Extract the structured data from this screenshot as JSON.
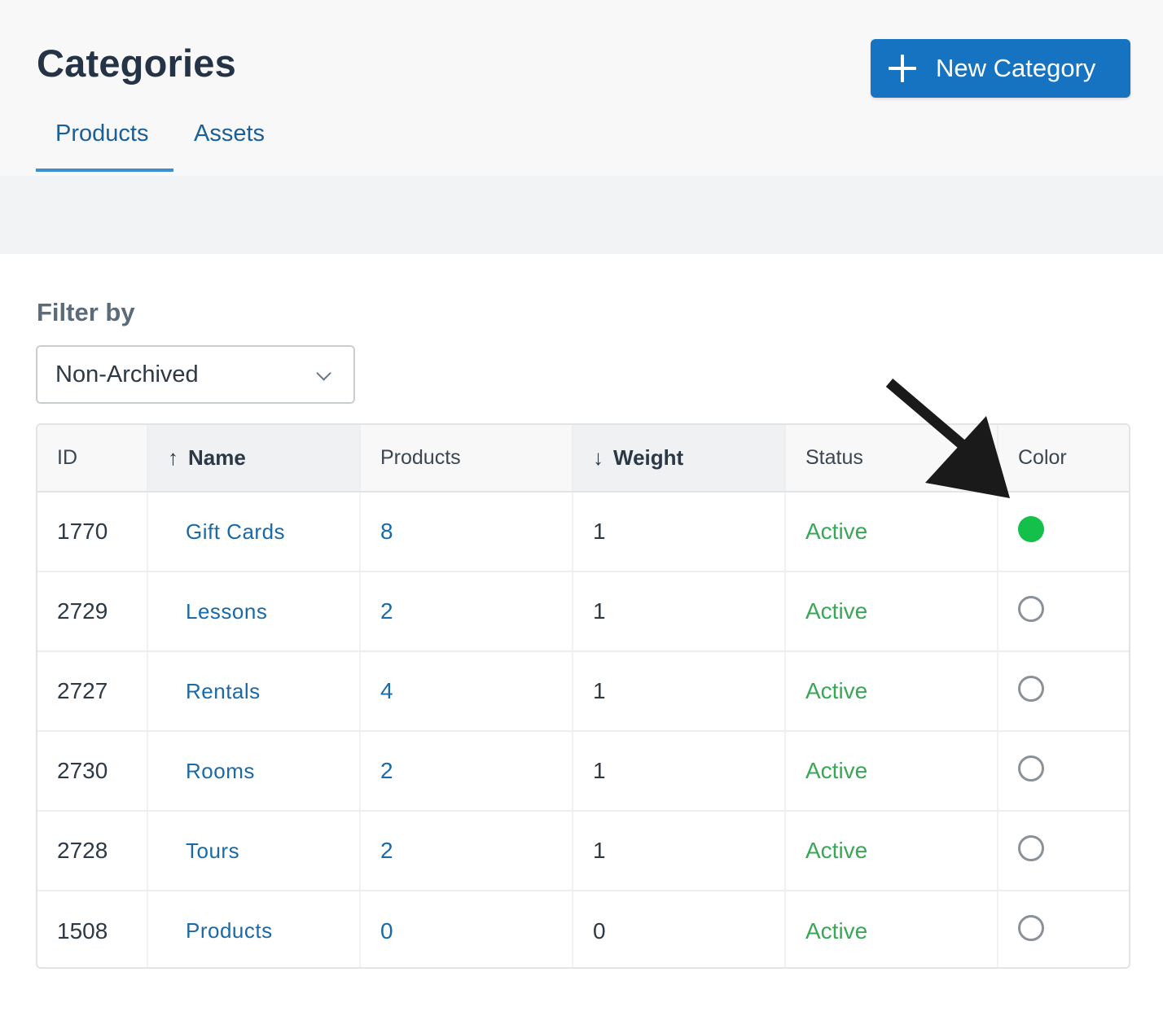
{
  "header": {
    "title": "Categories",
    "new_button_label": "New Category",
    "tabs": [
      {
        "label": "Products",
        "active": true
      },
      {
        "label": "Assets",
        "active": false
      }
    ]
  },
  "filter": {
    "label": "Filter by",
    "selected": "Non-Archived"
  },
  "table": {
    "columns": [
      {
        "label": "ID",
        "sort": ""
      },
      {
        "label": "Name",
        "sort": "↑"
      },
      {
        "label": "Products",
        "sort": ""
      },
      {
        "label": "Weight",
        "sort": "↓"
      },
      {
        "label": "Status",
        "sort": ""
      },
      {
        "label": "Color",
        "sort": ""
      }
    ],
    "rows": [
      {
        "id": "1770",
        "name": "Gift Cards",
        "products": "8",
        "weight": "1",
        "status": "Active",
        "color": "#15c04a"
      },
      {
        "id": "2729",
        "name": "Lessons",
        "products": "2",
        "weight": "1",
        "status": "Active",
        "color": ""
      },
      {
        "id": "2727",
        "name": "Rentals",
        "products": "4",
        "weight": "1",
        "status": "Active",
        "color": ""
      },
      {
        "id": "2730",
        "name": "Rooms",
        "products": "2",
        "weight": "1",
        "status": "Active",
        "color": ""
      },
      {
        "id": "2728",
        "name": "Tours",
        "products": "2",
        "weight": "1",
        "status": "Active",
        "color": ""
      },
      {
        "id": "1508",
        "name": "Products",
        "products": "0",
        "weight": "0",
        "status": "Active",
        "color": ""
      }
    ]
  },
  "colors": {
    "accent": "#1673c1",
    "link": "#1b6aa8",
    "status_active": "#3aa757",
    "swatch_set": "#15c04a"
  },
  "icons": {
    "new_button": "plus-icon",
    "select": "chevron-down-icon",
    "annotation": "arrow-pointer-icon"
  }
}
